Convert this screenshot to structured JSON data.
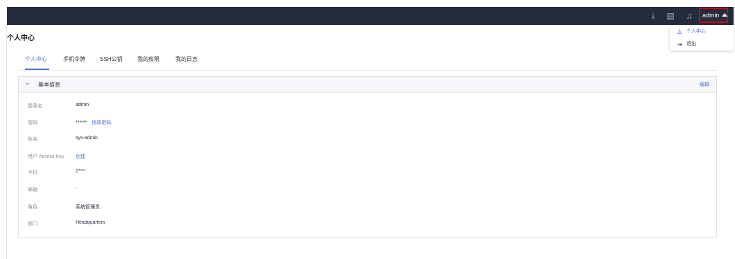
{
  "topbar": {
    "icons": [
      "download-icon",
      "document-icon",
      "bell-icon"
    ],
    "user_label": "admin"
  },
  "dropdown": {
    "items": [
      {
        "label": "个人中心",
        "icon": "user-icon"
      },
      {
        "label": "退出",
        "icon": "logout-icon"
      }
    ]
  },
  "page": {
    "title": "个人中心"
  },
  "tabs": [
    {
      "label": "个人中心",
      "active": true
    },
    {
      "label": "手机令牌"
    },
    {
      "label": "SSH公钥"
    },
    {
      "label": "我的权限"
    },
    {
      "label": "我的日志"
    }
  ],
  "card": {
    "title": "基本信息",
    "edit_label": "编辑",
    "rows": [
      {
        "label": "登录名",
        "value": "admin"
      },
      {
        "label": "密码",
        "value": "******",
        "link": "修改密码"
      },
      {
        "label": "姓名",
        "value": "sys-admin"
      },
      {
        "label": "用户 Access Key",
        "link": "创建"
      },
      {
        "label": "手机",
        "value": "1****"
      },
      {
        "label": "邮箱",
        "value": "-"
      },
      {
        "label": "角色",
        "value": "系统管理员"
      },
      {
        "label": "部门",
        "value": "Headquarters"
      }
    ]
  }
}
